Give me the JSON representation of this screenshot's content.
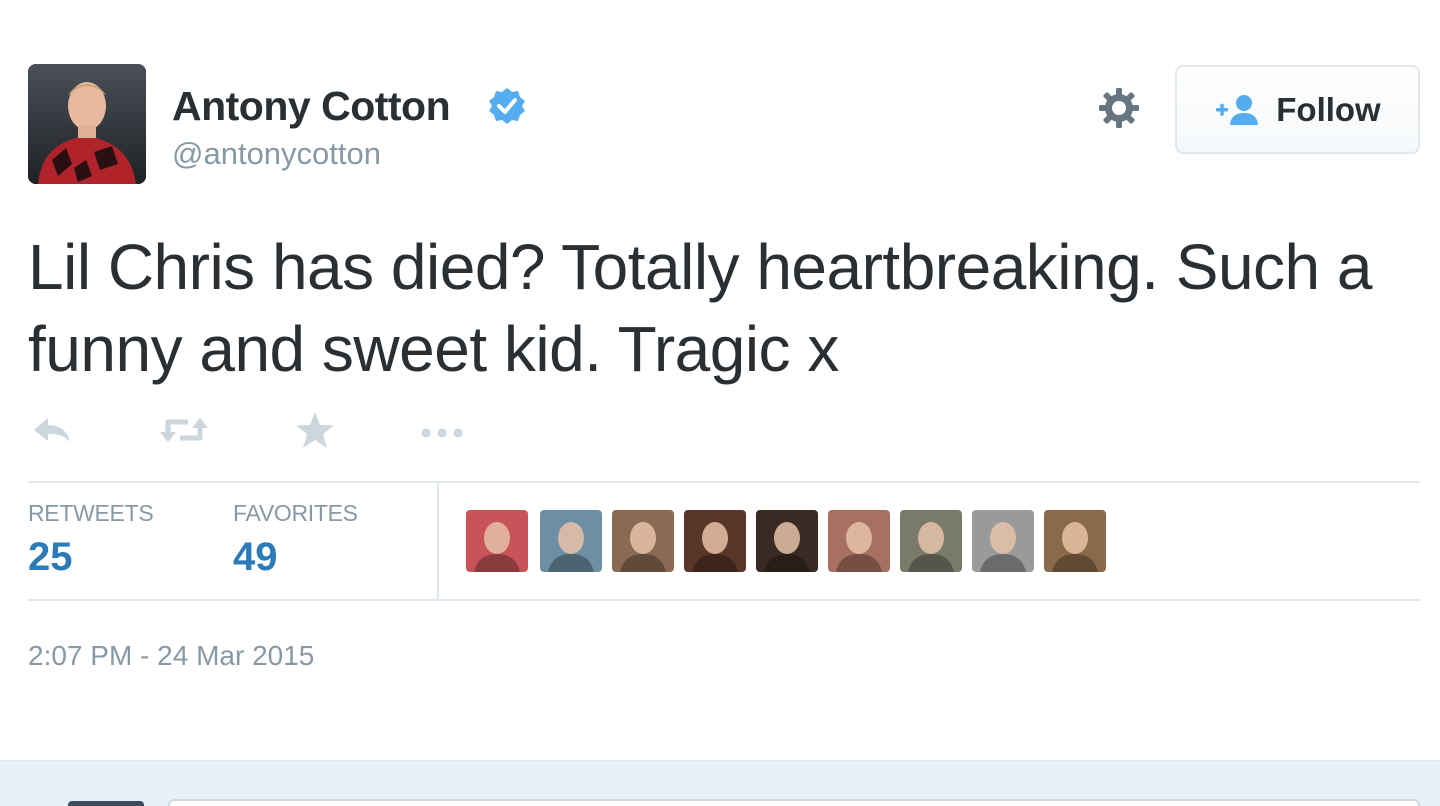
{
  "user": {
    "name": "Antony Cotton",
    "handle": "@antonycotton",
    "verified": true
  },
  "follow_button": {
    "label": "Follow"
  },
  "tweet": {
    "text": "Lil Chris has died? Totally heartbreaking. Such a funny and sweet kid. Tragic x",
    "timestamp": "2:07 PM - 24 Mar 2015"
  },
  "actions": {
    "reply_icon": "reply-arrow-icon",
    "retweet_icon": "retweet-icon",
    "favorite_icon": "star-icon",
    "more_icon": "ellipsis-icon"
  },
  "stats": {
    "retweets_label": "RETWEETS",
    "retweets_value": "25",
    "favorites_label": "FAVORITES",
    "favorites_value": "49"
  },
  "favoriters": [
    {
      "icon": "user-avatar",
      "color": "#c8545a"
    },
    {
      "icon": "user-avatar",
      "color": "#6e8fa3"
    },
    {
      "icon": "user-avatar",
      "color": "#8a6a52"
    },
    {
      "icon": "user-avatar",
      "color": "#5a3628"
    },
    {
      "icon": "user-avatar",
      "color": "#3a2a24"
    },
    {
      "icon": "user-avatar",
      "color": "#a87062"
    },
    {
      "icon": "user-avatar",
      "color": "#7a7a6a"
    },
    {
      "icon": "user-avatar",
      "color": "#9a9a9a"
    },
    {
      "icon": "user-avatar",
      "color": "#8a6a4a"
    }
  ],
  "colors": {
    "link_blue": "#2b7bb9",
    "text_dark": "#292f33",
    "text_muted": "#8899a6",
    "verified_blue": "#55acee",
    "divider": "#e1e8ed",
    "reply_bar_bg": "#e8f1f8"
  }
}
